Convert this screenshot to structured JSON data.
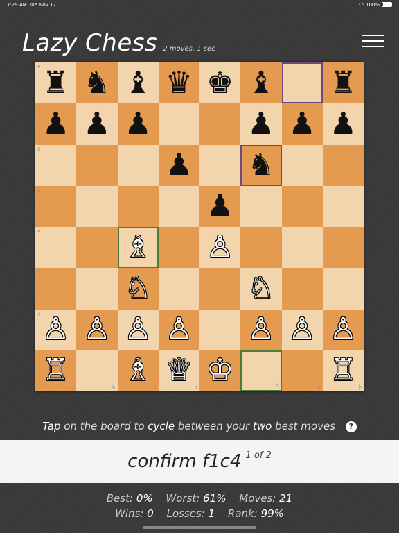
{
  "status_bar": {
    "time": "7:29 AM",
    "date": "Tue Nov 17",
    "battery": "100%"
  },
  "header": {
    "title": "Lazy Chess",
    "subtitle": "2 moves, 1 sec"
  },
  "board": {
    "ranks": [
      [
        "♜",
        "♞",
        "♝",
        "♛",
        "♚",
        "♝",
        "",
        "♜"
      ],
      [
        "♟",
        "♟",
        "♟",
        "",
        "",
        "♟",
        "♟",
        "♟"
      ],
      [
        "",
        "",
        "",
        "♟",
        "",
        "♞",
        "",
        ""
      ],
      [
        "",
        "",
        "",
        "",
        "♟",
        "",
        "",
        ""
      ],
      [
        "",
        "",
        "♗",
        "",
        "♙",
        "",
        "",
        ""
      ],
      [
        "",
        "",
        "♘",
        "",
        "",
        "♘",
        "",
        ""
      ],
      [
        "♙",
        "♙",
        "♙",
        "♙",
        "",
        "♙",
        "♙",
        "♙"
      ],
      [
        "♖",
        "",
        "♗",
        "♕",
        "♔",
        "",
        "",
        "♖"
      ]
    ],
    "rank_labels": [
      "8",
      "7",
      "6",
      "5",
      "4",
      "3",
      "2",
      "1"
    ],
    "file_labels": [
      "a",
      "b",
      "c",
      "d",
      "e",
      "f",
      "g",
      "h"
    ],
    "highlight_purple": [
      "g8",
      "f6"
    ],
    "highlight_green": [
      "c4",
      "f1"
    ]
  },
  "hint": {
    "pre": "Tap",
    "mid1": " on the board to ",
    "cycle": "cycle",
    "mid2": " between your ",
    "two": "two",
    "post": " best moves",
    "help": "?"
  },
  "confirm": {
    "text": "confirm f1c4",
    "count": "1 of 2"
  },
  "stats": {
    "best_label": "Best:",
    "best": "0%",
    "worst_label": "Worst:",
    "worst": "61%",
    "moves_label": "Moves:",
    "moves": "21",
    "wins_label": "Wins:",
    "wins": "0",
    "losses_label": "Losses:",
    "losses": "1",
    "rank_label": "Rank:",
    "rank": "99%"
  }
}
